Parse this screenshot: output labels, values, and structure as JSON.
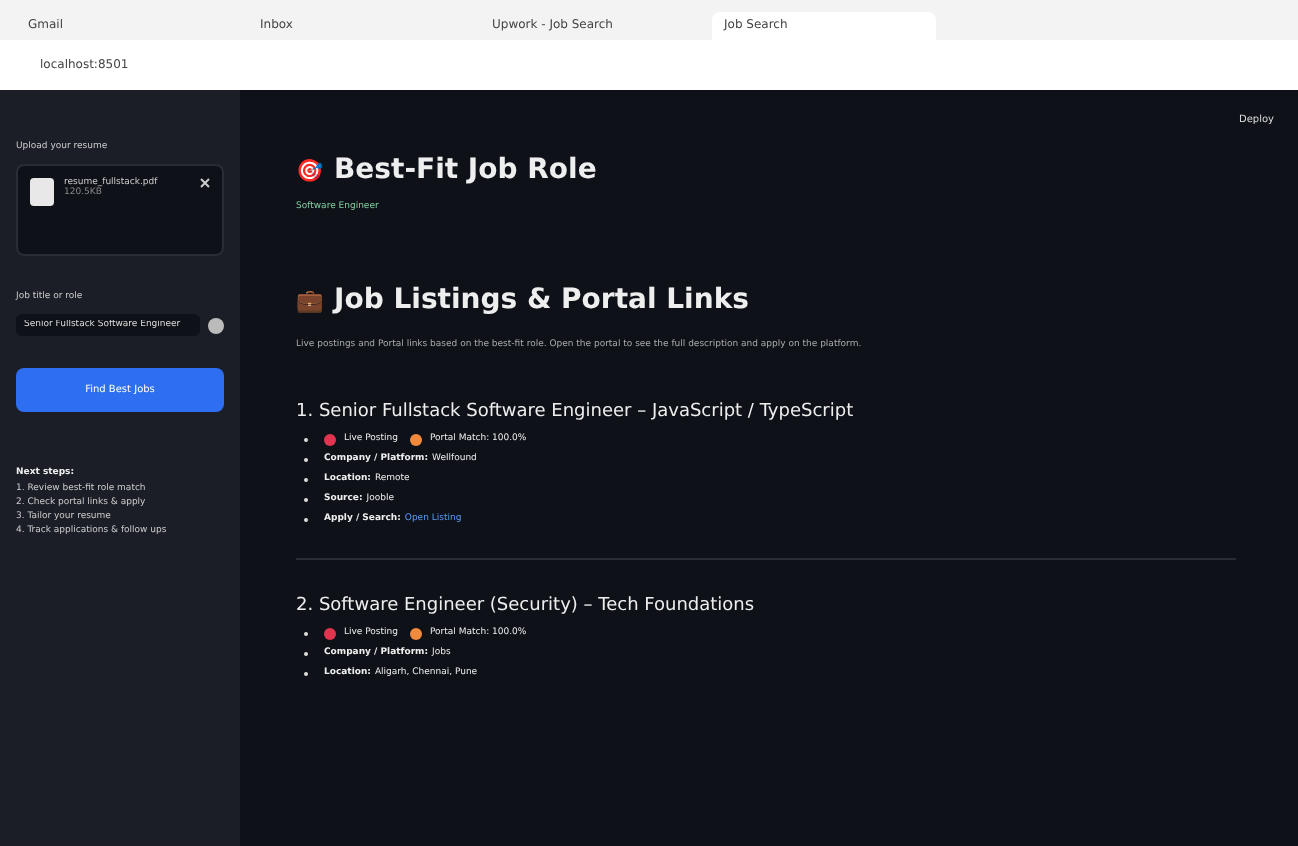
{
  "browser": {
    "tabs": [
      {
        "label": "Gmail",
        "selected": false
      },
      {
        "label": "Inbox",
        "selected": false
      },
      {
        "label": "Upwork - Job Search",
        "selected": false
      },
      {
        "label": "Job Search",
        "selected": true
      }
    ],
    "address": "localhost:8501"
  },
  "app": {
    "deploy": "Deploy"
  },
  "sidebar": {
    "upload_label": "Upload your resume",
    "file": {
      "name": "resume_fullstack.pdf",
      "size": "120.5KB"
    },
    "input_label": "Job title or role",
    "input_value": "Senior Fullstack Software Engineer",
    "button": "Find Best Jobs",
    "notes_title": "Next steps:",
    "notes": [
      "1. Review best-fit role match",
      "2. Check portal links & apply",
      "3. Tailor your resume",
      "4. Track applications & follow ups"
    ]
  },
  "main": {
    "best_fit": {
      "icon": "🎯",
      "title": "Best-Fit Job Role",
      "subtitle": "Software Engineer"
    },
    "listings": {
      "icon": "💼",
      "title": "Job Listings & Portal Links",
      "intro": "Live postings and Portal links based on the best-fit role. Open the portal to see the full description and apply on the platform.",
      "jobs": [
        {
          "title": "1. Senior Fullstack Software Engineer – JavaScript / TypeScript",
          "fields": [
            {
              "kind": "tags",
              "tags": [
                {
                  "text": "Live Posting",
                  "color": "#e0344f"
                },
                {
                  "text": "Portal Match: 100.0%",
                  "color": "#f08a3c"
                }
              ]
            },
            {
              "kind": "text",
              "label": "Company / Platform:",
              "value": "Wellfound"
            },
            {
              "kind": "text",
              "label": "Location:",
              "value": "Remote"
            },
            {
              "kind": "text",
              "label": "Source:",
              "value": "Jooble"
            },
            {
              "kind": "link",
              "label": "Apply / Search:",
              "value": "Open Listing"
            }
          ]
        },
        {
          "title": "2. Software Engineer (Security) – Tech Foundations",
          "fields": [
            {
              "kind": "tags",
              "tags": [
                {
                  "text": "Live Posting",
                  "color": "#e0344f"
                },
                {
                  "text": "Portal Match: 100.0%",
                  "color": "#f08a3c"
                }
              ]
            },
            {
              "kind": "text",
              "label": "Company / Platform:",
              "value": "Jobs"
            },
            {
              "kind": "text",
              "label": "Location:",
              "value": "Aligarh, Chennai, Pune"
            }
          ]
        }
      ]
    }
  }
}
